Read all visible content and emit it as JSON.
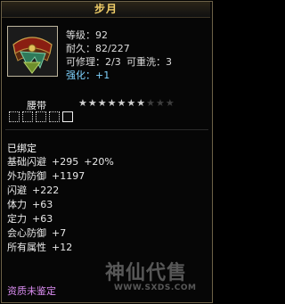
{
  "tooltip": {
    "title": "步月",
    "level_label": "等级：",
    "level_value": "92",
    "durability_label": "耐久：",
    "durability_value": "82/227",
    "repair_label": "可修理：",
    "repair_value": "2/3",
    "rewash_label": "可重洗：",
    "rewash_value": "3",
    "enhance_label": "强化：",
    "enhance_value": "+1",
    "item_type": "腰带",
    "star_rating": 7,
    "star_max": 10,
    "sockets": 5,
    "bound_text": "已绑定",
    "attributes": [
      {
        "name": "基础闪避",
        "value": "+295",
        "extra": "+20%"
      },
      {
        "name": "外功防御",
        "value": "+1197",
        "extra": ""
      },
      {
        "name": "闪避",
        "value": "+222",
        "extra": ""
      },
      {
        "name": "体力",
        "value": "+63",
        "extra": ""
      },
      {
        "name": "定力",
        "value": "+63",
        "extra": ""
      },
      {
        "name": "会心防御",
        "value": "+7",
        "extra": ""
      },
      {
        "name": "所有属性",
        "value": "+12",
        "extra": ""
      }
    ],
    "quality_text": "资质未鉴定"
  },
  "watermark": {
    "cn": "神仙代售",
    "url": "WWW.SXDS.COM"
  },
  "colors": {
    "title": "#f3d06a",
    "enhance": "#7fd4ff",
    "quality": "#d98cf0",
    "star_active": "#cfcfcf",
    "star_inactive": "#3e3e3e"
  },
  "icons": {
    "item": "belt-icon",
    "star": "star-icon",
    "socket": "socket-slot-icon"
  }
}
